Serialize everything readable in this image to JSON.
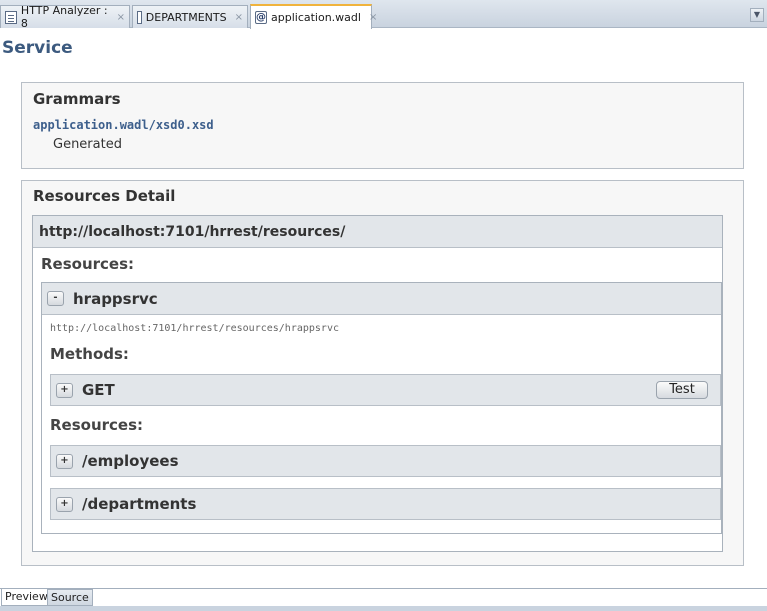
{
  "tabs": [
    {
      "label": "HTTP Analyzer : 8",
      "close": "×",
      "icon": "document-icon"
    },
    {
      "label": "DEPARTMENTS",
      "close": "×",
      "icon": "table-grid-icon"
    },
    {
      "label": "application.wadl",
      "close": "×",
      "icon": "wadl-at-icon"
    }
  ],
  "menu_arrow": "▼",
  "page": {
    "title": "Service"
  },
  "grammars": {
    "title": "Grammars",
    "link": "application.wadl/xsd0.xsd",
    "status": "Generated"
  },
  "resources_detail": {
    "title": "Resources Detail",
    "base_url": "http://localhost:7101/hrrest/resources/",
    "resources_label": "Resources:",
    "resource": {
      "toggle": "-",
      "name": "hrappsrvc",
      "url": "http://localhost:7101/hrrest/resources/hrappsrvc",
      "methods_label": "Methods:",
      "methods": [
        {
          "toggle": "+",
          "name": "GET",
          "button": "Test"
        }
      ],
      "sub_resources_label": "Resources:",
      "sub_resources": [
        {
          "toggle": "+",
          "name": "/employees"
        },
        {
          "toggle": "+",
          "name": "/departments"
        }
      ]
    }
  },
  "bottom_tabs": [
    {
      "label": "Preview",
      "active": true
    },
    {
      "label": "Source",
      "active": false
    }
  ]
}
